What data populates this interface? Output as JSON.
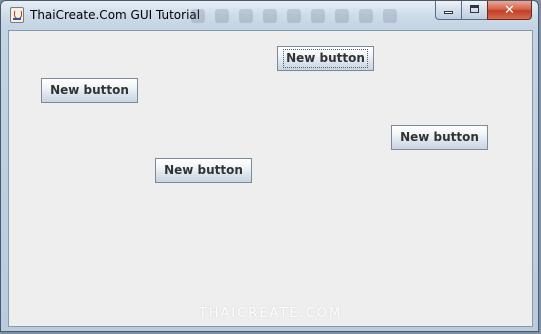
{
  "window": {
    "title": "ThaiCreate.Com GUI Tutorial",
    "controls": {
      "minimize_icon": "minimize-icon",
      "maximize_icon": "maximize-icon",
      "close_label": "✕"
    }
  },
  "buttons": [
    {
      "label": "New button",
      "focused": true
    },
    {
      "label": "New button",
      "focused": false
    },
    {
      "label": "New button",
      "focused": false
    },
    {
      "label": "New button",
      "focused": false
    }
  ],
  "watermark": {
    "text": "THAICREATE.COM"
  },
  "colors": {
    "content_background": "#eeeeee",
    "button_border": "#7a8a99",
    "titlebar": "#c2d3e4",
    "close_button": "#c0402a"
  }
}
